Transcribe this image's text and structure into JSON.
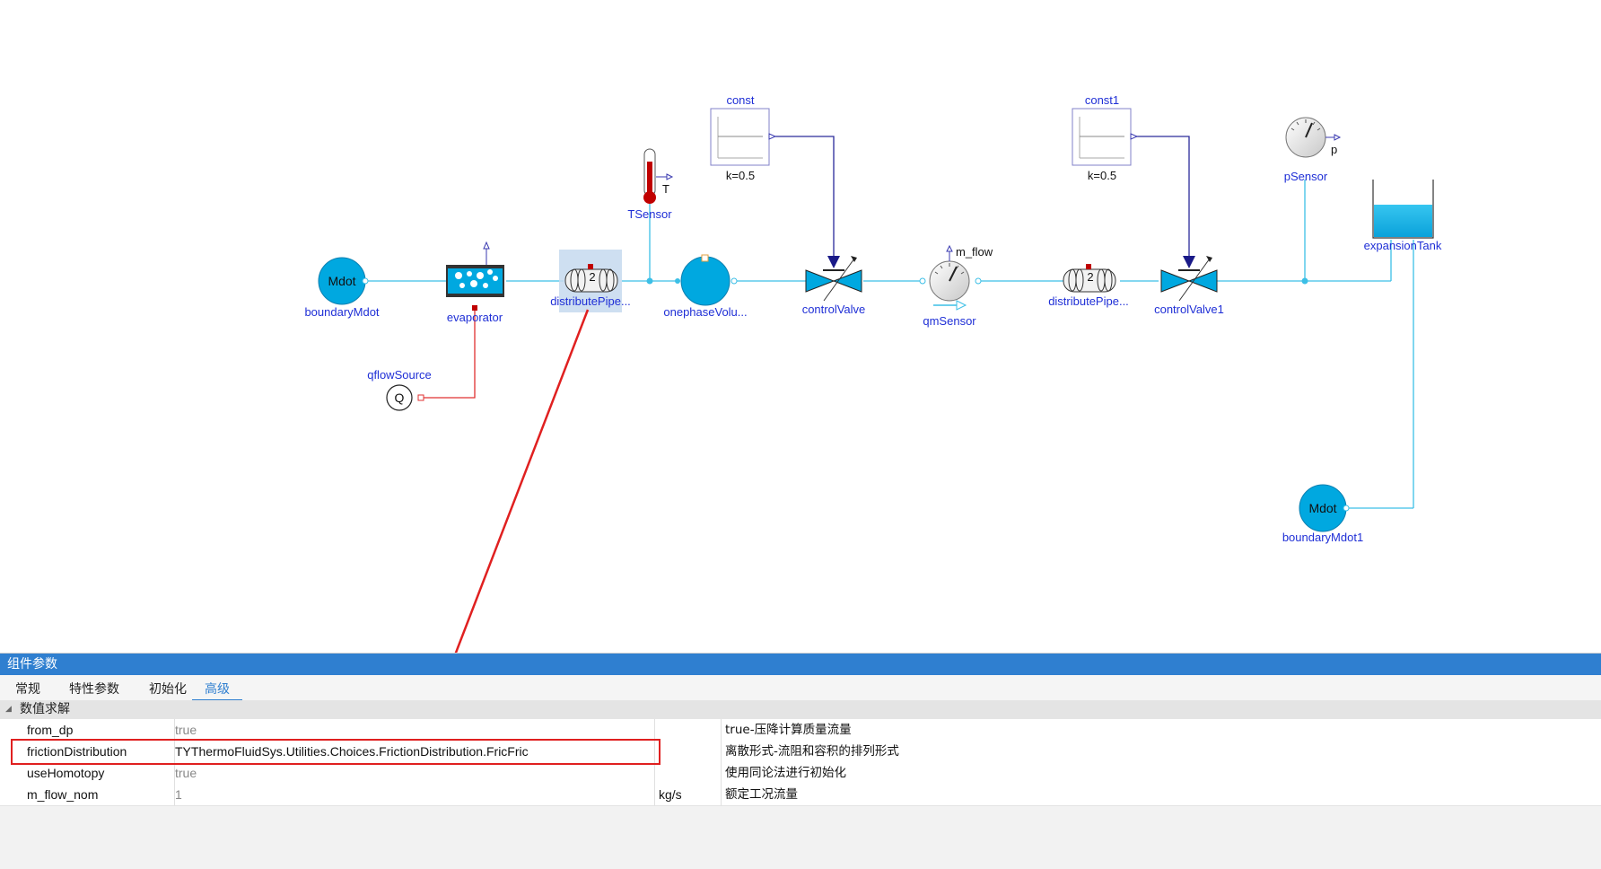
{
  "diagram": {
    "labels": {
      "boundaryMdot": "boundaryMdot",
      "evaporator": "evaporator",
      "distributePipe": "distributePipe...",
      "onephaseVolume": "onephaseVolu...",
      "controlValve": "controlValve",
      "qmSensor": "qmSensor",
      "distributePipe1": "distributePipe...",
      "controlValve1": "controlValve1",
      "pSensor": "pSensor",
      "expansionTank": "expansionTank",
      "boundaryMdot1": "boundaryMdot1",
      "qflowSource": "qflowSource",
      "TSensor": "TSensor",
      "const": "const",
      "const1": "const1",
      "k_const": "k=0.5",
      "k_const1": "k=0.5",
      "m_flow": "m_flow",
      "T": "T",
      "p": "p",
      "Mdot": "Mdot",
      "Mdot1": "Mdot",
      "Q": "Q",
      "pipeN": "2",
      "pipeN1": "2"
    }
  },
  "panel": {
    "title": "组件参数",
    "tabs": [
      "常规",
      "特性参数",
      "初始化",
      "高级"
    ],
    "active_tab": "高级",
    "group": "数值求解",
    "rows": [
      {
        "name": "from_dp",
        "value": "true",
        "unit": "",
        "desc": "true-压降计算质量流量"
      },
      {
        "name": "frictionDistribution",
        "value": "TYThermoFluidSys.Utilities.Choices.FrictionDistribution.FricFric",
        "unit": "",
        "desc": "离散形式-流阻和容积的排列形式"
      },
      {
        "name": "useHomotopy",
        "value": "true",
        "unit": "",
        "desc": "使用同论法进行初始化"
      },
      {
        "name": "m_flow_nom",
        "value": "1",
        "unit": "kg/s",
        "desc": "额定工况流量"
      }
    ]
  },
  "colors": {
    "pipe": "#3cbfe6",
    "component": "#00a8e0",
    "label": "#1f2fd6",
    "control": "#2a2a9a",
    "heat": "#e03030",
    "accent": "#2f7fd0",
    "annotation": "#e02020"
  }
}
